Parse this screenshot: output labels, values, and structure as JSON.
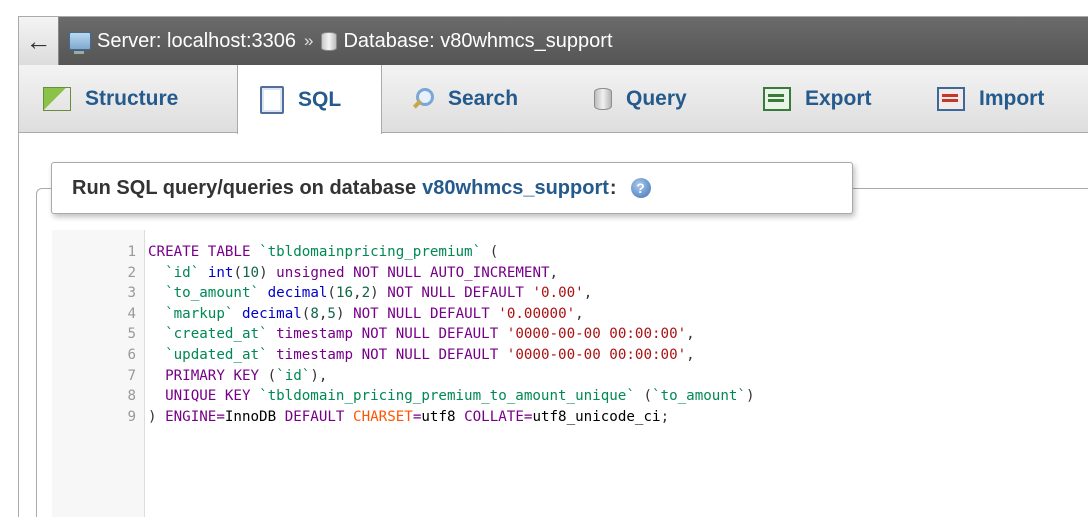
{
  "breadcrumb": {
    "back": "←",
    "server": "Server: localhost:3306",
    "separator": "»",
    "database": "Database: v80whmcs_support"
  },
  "tabs": [
    {
      "label": "Structure",
      "icon": "structure-icon"
    },
    {
      "label": "SQL",
      "icon": "sql-icon",
      "active": true
    },
    {
      "label": "Search",
      "icon": "search-icon"
    },
    {
      "label": "Query",
      "icon": "query-icon"
    },
    {
      "label": "Export",
      "icon": "export-icon"
    },
    {
      "label": "Import",
      "icon": "import-icon"
    }
  ],
  "panel": {
    "title_prefix": "Run SQL query/queries on database",
    "db_name": "v80whmcs_support",
    "colon": ":",
    "help": "?"
  },
  "editor": {
    "line_numbers": [
      "1",
      "2",
      "3",
      "4",
      "5",
      "6",
      "7",
      "8",
      "9"
    ],
    "lines": [
      "CREATE TABLE `tbldomainpricing_premium` (",
      "  `id` int(10) unsigned NOT NULL AUTO_INCREMENT,",
      "  `to_amount` decimal(16,2) NOT NULL DEFAULT '0.00',",
      "  `markup` decimal(8,5) NOT NULL DEFAULT '0.00000',",
      "  `created_at` timestamp NOT NULL DEFAULT '0000-00-00 00:00:00',",
      "  `updated_at` timestamp NOT NULL DEFAULT '0000-00-00 00:00:00',",
      "  PRIMARY KEY (`id`),",
      "  UNIQUE KEY `tbldomain_pricing_premium_to_amount_unique` (`to_amount`)",
      ") ENGINE=InnoDB DEFAULT CHARSET=utf8 COLLATE=utf8_unicode_ci;"
    ]
  },
  "colors": {
    "tab_text": "#245b8c",
    "keyword": "#770088",
    "string": "#aa1111",
    "identifier": "#008855",
    "number": "#116644"
  }
}
